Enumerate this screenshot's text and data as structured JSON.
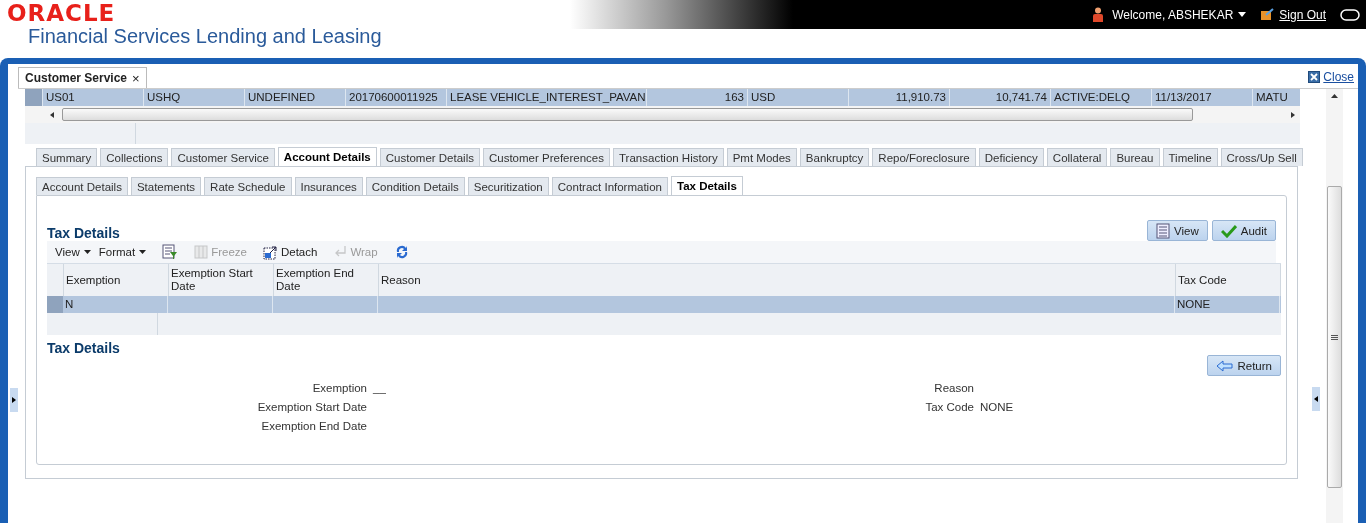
{
  "header": {
    "brand": "ORACLE",
    "product": "Financial Services Lending and Leasing",
    "welcome": "Welcome, ABSHEKAR",
    "sign_out": "Sign Out"
  },
  "page_tab": {
    "label": "Customer Service",
    "close": "×"
  },
  "close_link": "Close",
  "summary_row": {
    "selected": true,
    "cells": [
      "US01",
      "USHQ",
      "UNDEFINED",
      "20170600011925",
      "LEASE VEHICLE_INTEREST_PAVAN",
      "163",
      "USD",
      "11,910.73",
      "10,741.74",
      "ACTIVE:DELQ",
      "11/13/2017",
      "MATU"
    ]
  },
  "tabs": [
    {
      "label": "Summary",
      "selected": false
    },
    {
      "label": "Collections",
      "selected": false
    },
    {
      "label": "Customer Service",
      "selected": false
    },
    {
      "label": "Account Details",
      "selected": true
    },
    {
      "label": "Customer Details",
      "selected": false
    },
    {
      "label": "Customer Preferences",
      "selected": false
    },
    {
      "label": "Transaction History",
      "selected": false
    },
    {
      "label": "Pmt Modes",
      "selected": false
    },
    {
      "label": "Bankruptcy",
      "selected": false
    },
    {
      "label": "Repo/Foreclosure",
      "selected": false
    },
    {
      "label": "Deficiency",
      "selected": false
    },
    {
      "label": "Collateral",
      "selected": false
    },
    {
      "label": "Bureau",
      "selected": false
    },
    {
      "label": "Timeline",
      "selected": false
    },
    {
      "label": "Cross/Up Sell",
      "selected": false
    }
  ],
  "sub_tabs": [
    {
      "label": "Account Details",
      "selected": false
    },
    {
      "label": "Statements",
      "selected": false
    },
    {
      "label": "Rate Schedule",
      "selected": false
    },
    {
      "label": "Insurances",
      "selected": false
    },
    {
      "label": "Condition Details",
      "selected": false
    },
    {
      "label": "Securitization",
      "selected": false
    },
    {
      "label": "Contract Information",
      "selected": false
    },
    {
      "label": "Tax Details",
      "selected": true
    }
  ],
  "table_section": {
    "title": "Tax Details",
    "buttons": [
      {
        "label": "View",
        "kind": "view"
      },
      {
        "label": "Audit",
        "kind": "audit"
      }
    ],
    "toolbar": [
      {
        "label": "View",
        "kind": "menu",
        "disabled": false
      },
      {
        "label": "Format",
        "kind": "menu",
        "disabled": false
      },
      {
        "kind": "filter",
        "disabled": false
      },
      {
        "label": "Freeze",
        "kind": "freeze",
        "disabled": true
      },
      {
        "label": "Detach",
        "kind": "detach",
        "disabled": false
      },
      {
        "label": "Wrap",
        "kind": "wrap",
        "disabled": true
      },
      {
        "kind": "refresh",
        "disabled": false
      }
    ],
    "columns": [
      "Exemption",
      "Exemption Start Date",
      "Exemption End Date",
      "Reason",
      "Tax Code"
    ],
    "rows": [
      {
        "selected": true,
        "cells": [
          "N",
          "",
          "",
          "",
          "NONE"
        ]
      }
    ]
  },
  "detail_section": {
    "title": "Tax Details",
    "return_button": "Return",
    "left_fields": [
      {
        "label": "Exemption",
        "value": "__"
      },
      {
        "label": "Exemption Start Date"
      },
      {
        "label": "Exemption End Date"
      }
    ],
    "right_fields": [
      {
        "label": "Reason"
      },
      {
        "label": "Tax Code",
        "value": "NONE"
      }
    ]
  }
}
